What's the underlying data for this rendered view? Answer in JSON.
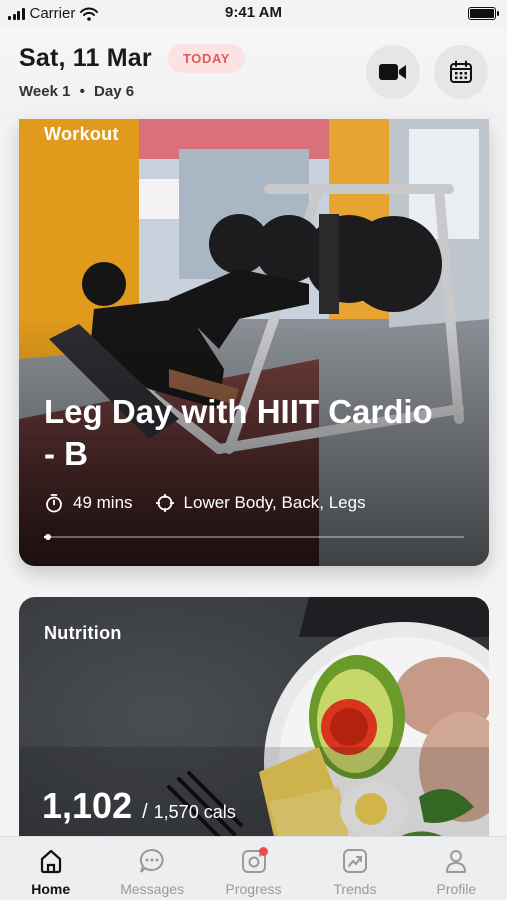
{
  "status_bar": {
    "carrier": "Carrier",
    "time": "9:41 AM"
  },
  "header": {
    "date": "Sat, 11 Mar",
    "today_badge": "TODAY",
    "week": "Week 1",
    "separator": "•",
    "day": "Day 6",
    "video_icon": "video-camera-icon",
    "calendar_icon": "calendar-icon"
  },
  "workout": {
    "label": "Workout",
    "title": "Leg Day with HIIT Cardio - B",
    "duration": "49 mins",
    "focus": "Lower Body, Back, Legs",
    "progress": 0.01
  },
  "nutrition": {
    "label": "Nutrition",
    "consumed": "1,102",
    "slash": "/",
    "target": "1,570 cals"
  },
  "tabs": [
    {
      "label": "Home",
      "icon": "home-icon",
      "active": true
    },
    {
      "label": "Messages",
      "icon": "chat-bubble-icon",
      "active": false
    },
    {
      "label": "Progress",
      "icon": "camera-icon",
      "active": false,
      "badge": true
    },
    {
      "label": "Trends",
      "icon": "trend-chart-icon",
      "active": false
    },
    {
      "label": "Profile",
      "icon": "person-icon",
      "active": false
    }
  ],
  "colors": {
    "accent_red": "#e35a5a",
    "badge_bg": "#fbe3e3",
    "badge_dot": "#e84d4d"
  }
}
